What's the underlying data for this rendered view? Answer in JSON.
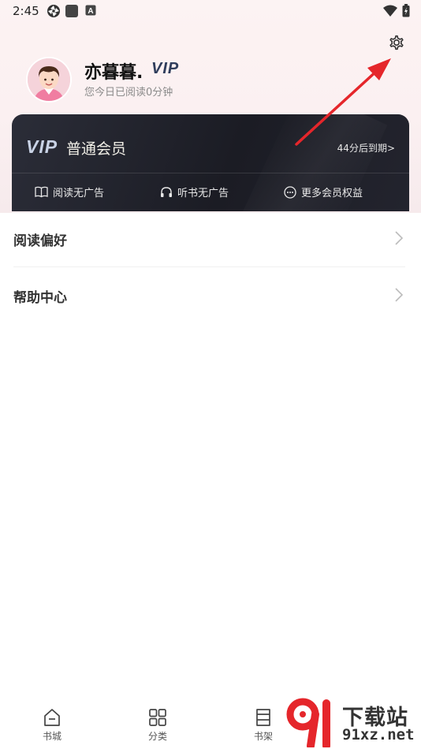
{
  "status_bar": {
    "time": "2:45",
    "icons": [
      "pinwheel-icon",
      "square-icon",
      "a-box-icon",
      "wifi-icon",
      "battery-icon"
    ]
  },
  "profile": {
    "username": "亦暮暮.",
    "vip_badge": "VIP",
    "read_time": "您今日已阅读0分钟"
  },
  "vip_card": {
    "logo": "VIP",
    "title": "普通会员",
    "expiry": "44分后到期>",
    "benefits": [
      {
        "label": "阅读无广告",
        "icon": "book-icon"
      },
      {
        "label": "听书无广告",
        "icon": "headphones-icon"
      },
      {
        "label": "更多会员权益",
        "icon": "more-circle-icon"
      }
    ]
  },
  "menu": [
    {
      "label": "阅读偏好"
    },
    {
      "label": "帮助中心"
    }
  ],
  "bottom_nav": [
    {
      "label": "书城",
      "icon": "home-icon"
    },
    {
      "label": "分类",
      "icon": "grid-icon"
    },
    {
      "label": "书架",
      "icon": "bookshelf-icon"
    }
  ],
  "watermark": {
    "text": "下载站",
    "url": "91xz.net"
  },
  "colors": {
    "accent_red": "#e5262b",
    "card_bg": "#1e1f27",
    "header_bg": "#fbf0f1"
  }
}
